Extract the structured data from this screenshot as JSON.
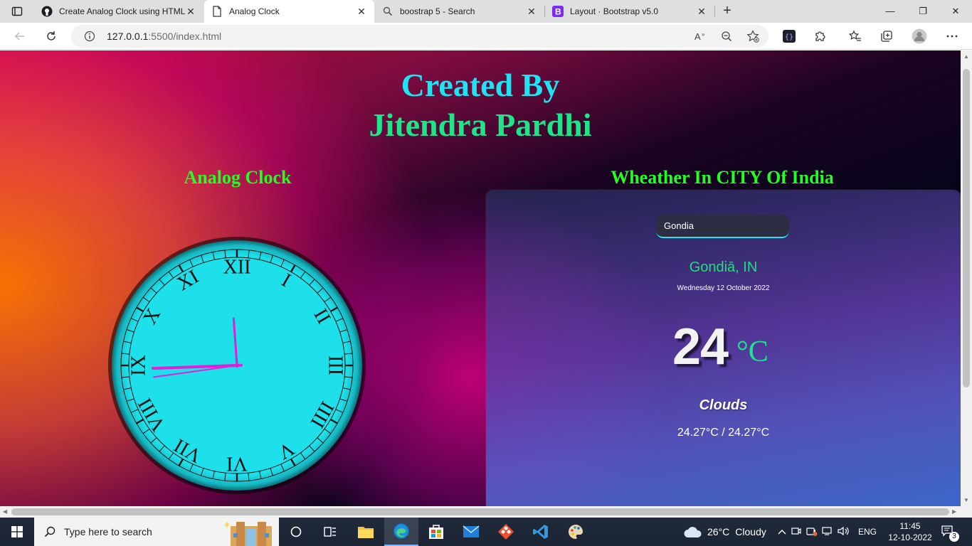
{
  "browser": {
    "tabs": [
      {
        "label": "Create Analog Clock using HTML",
        "close": "✕"
      },
      {
        "label": "Analog Clock",
        "close": "✕"
      },
      {
        "label": "boostrap 5 - Search",
        "close": "✕"
      },
      {
        "label": "Layout · Bootstrap v5.0",
        "close": "✕"
      }
    ],
    "new_tab": "+",
    "window": {
      "minimize": "—",
      "maximize": "❐",
      "close": "✕"
    },
    "url_host": "127.0.0.1",
    "url_path": ":5500/index.html"
  },
  "page": {
    "title_line1": "Created By",
    "title_line2": "Jitendra Pardhi",
    "clock_heading": "Analog Clock",
    "weather_heading": "Wheather In CITY Of India"
  },
  "clock": {
    "numerals": [
      "XII",
      "I",
      "II",
      "III",
      "IIII",
      "V",
      "VI",
      "VII",
      "VIII",
      "IX",
      "X",
      "XI"
    ],
    "hour_hand_angle": -4,
    "minute_hand_angle": 268,
    "second_hand_angle": 262,
    "face_color": "#1ee0ea"
  },
  "weather": {
    "search_value": "Gondia",
    "city": "Gondiā, IN",
    "date": "Wednesday 12 October 2022",
    "temperature": "24",
    "unit": "°C",
    "condition": "Clouds",
    "range": "24.27°C / 24.27°C"
  },
  "taskbar": {
    "search_placeholder": "Type here to search",
    "weather_temp": "26°C",
    "weather_text": "Cloudy",
    "language": "ENG",
    "time": "11:45",
    "date": "12-10-2022",
    "notifications": "3"
  }
}
